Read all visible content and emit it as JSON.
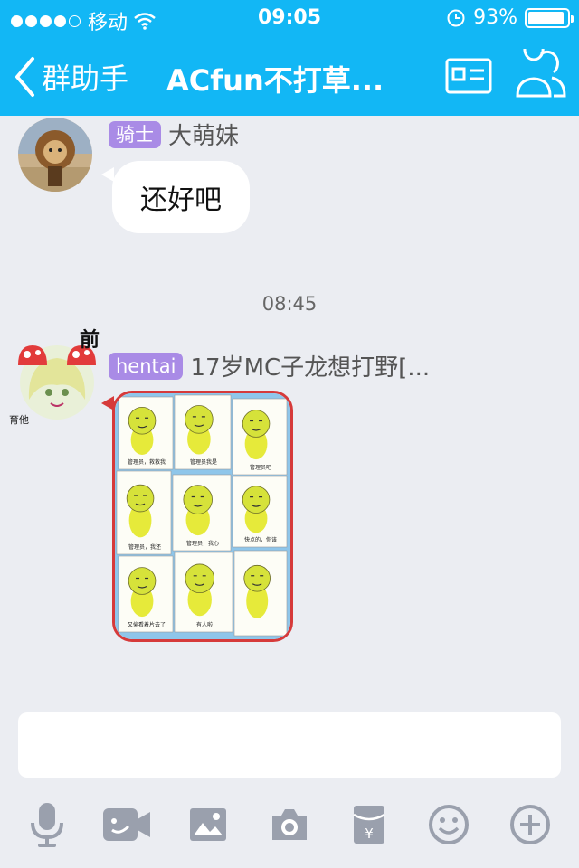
{
  "status_bar": {
    "carrier": "移动",
    "time": "09:05",
    "battery_percent": "93%",
    "battery_level": 0.93
  },
  "nav": {
    "back_label": "群助手",
    "title": "ACfun不打草..."
  },
  "messages": [
    {
      "badge": "骑士",
      "badge_color": "#a98be6",
      "sender": "大萌妹",
      "text": "还好吧"
    },
    {
      "badge": "hentai",
      "badge_color": "#a98be6",
      "sender": "17岁MC子龙想打野[...",
      "avatar_text_top": "前",
      "avatar_text_bottom": "育他",
      "image_captions": [
        "管理员，救救我",
        "管理员我是",
        "管理员吧\n给我提个醒",
        "管理员，我还",
        "管理员，我心",
        "快点的，你该",
        "又偷看着片去了",
        "有人啦"
      ]
    }
  ],
  "timestamp": "08:45",
  "input": {
    "placeholder": ""
  },
  "toolbar": {
    "items": [
      "microphone-icon",
      "video-icon",
      "image-icon",
      "camera-icon",
      "red-packet-icon",
      "emoji-icon",
      "plus-icon"
    ]
  },
  "colors": {
    "header": "#12b7f5",
    "background": "#ebedf2",
    "icon_gray": "#9aa0ad",
    "badge": "#a98be6",
    "image_border": "#d63a3a"
  }
}
